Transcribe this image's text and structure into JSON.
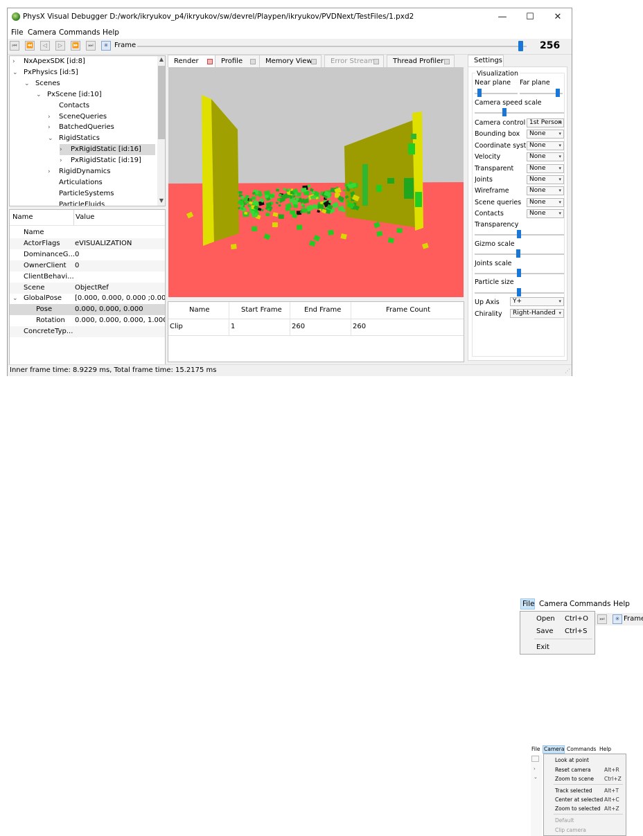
{
  "window": {
    "title": "PhysX Visual Debugger D:/work/ikryukov_p4/ikryukov/sw/devrel/Playpen/ikryukov/PVDNext/TestFiles/1.pxd2",
    "minimize": "—",
    "maximize": "☐",
    "close": "✕"
  },
  "menu": {
    "file": "File",
    "camera": "Camera",
    "commands": "Commands",
    "help": "Help"
  },
  "toolbar": {
    "frame_label": "Frame",
    "frame_value": "256",
    "frame_fraction": 0.985
  },
  "tree": [
    {
      "label": "NxApexSDK [id:8]",
      "chev": "›",
      "indent": 0
    },
    {
      "label": "PxPhysics [id:5]",
      "chev": "⌄",
      "indent": 0
    },
    {
      "label": "Scenes",
      "chev": "⌄",
      "indent": 1
    },
    {
      "label": "PxScene [id:10]",
      "chev": "⌄",
      "indent": 2
    },
    {
      "label": "Contacts",
      "chev": "",
      "indent": 3
    },
    {
      "label": "SceneQueries",
      "chev": "›",
      "indent": 3
    },
    {
      "label": "BatchedQueries",
      "chev": "›",
      "indent": 3
    },
    {
      "label": "RigidStatics",
      "chev": "⌄",
      "indent": 3
    },
    {
      "label": "PxRigidStatic [id:16]",
      "chev": "›",
      "indent": 4
    },
    {
      "label": "PxRigidStatic [id:19]",
      "chev": "›",
      "indent": 4
    },
    {
      "label": "RigidDynamics",
      "chev": "›",
      "indent": 3
    },
    {
      "label": "Articulations",
      "chev": "",
      "indent": 3
    },
    {
      "label": "ParticleSystems",
      "chev": "",
      "indent": 3
    },
    {
      "label": "ParticleFluids",
      "chev": "",
      "indent": 3
    }
  ],
  "props": {
    "header_name": "Name",
    "header_value": "Value",
    "rows": [
      {
        "name": "Name",
        "value": "",
        "indent": 1,
        "chev": ""
      },
      {
        "name": "ActorFlags",
        "value": "eVISUALIZATION",
        "indent": 1,
        "chev": ""
      },
      {
        "name": "DominanceG...",
        "value": "0",
        "indent": 1,
        "chev": ""
      },
      {
        "name": "OwnerClient",
        "value": "0",
        "indent": 1,
        "chev": ""
      },
      {
        "name": "ClientBehavi...",
        "value": "",
        "indent": 1,
        "chev": ""
      },
      {
        "name": "Scene",
        "value": "ObjectRef",
        "indent": 1,
        "chev": ""
      },
      {
        "name": "GlobalPose",
        "value": "[0.000, 0.000, 0.000 ;0.00...",
        "indent": 0,
        "chev": "⌄"
      },
      {
        "name": "Pose",
        "value": "0.000, 0.000, 0.000",
        "indent": 2,
        "chev": ""
      },
      {
        "name": "Rotation",
        "value": "0.000, 0.000, 0.000, 1.000",
        "indent": 2,
        "chev": ""
      },
      {
        "name": "ConcreteTyp...",
        "value": "",
        "indent": 1,
        "chev": ""
      }
    ]
  },
  "tabs": [
    {
      "label": "Render",
      "active": true
    },
    {
      "label": "Profile",
      "active": false
    },
    {
      "label": "Memory View",
      "active": false
    },
    {
      "label": "Error Stream",
      "active": false
    },
    {
      "label": "Thread Profiler",
      "active": false
    }
  ],
  "clips": {
    "headers": [
      "Name",
      "Start Frame",
      "End Frame",
      "Frame Count"
    ],
    "rows": [
      [
        "Clip",
        "1",
        "260",
        "260"
      ]
    ]
  },
  "settings": {
    "tab": "Settings",
    "group": "Visualization",
    "near_plane": "Near plane",
    "far_plane": "Far plane",
    "camera_speed": "Camera speed scale",
    "options": [
      {
        "label": "Camera controller",
        "value": "1st Person"
      },
      {
        "label": "Bounding box",
        "value": "None"
      },
      {
        "label": "Coordinate system",
        "value": "None"
      },
      {
        "label": "Velocity",
        "value": "None"
      },
      {
        "label": "Transparent",
        "value": "None"
      },
      {
        "label": "Joints",
        "value": "None"
      },
      {
        "label": "Wireframe",
        "value": "None"
      },
      {
        "label": "Scene queries",
        "value": "None"
      },
      {
        "label": "Contacts",
        "value": "None"
      }
    ],
    "transparency": "Transparency",
    "gizmo_scale": "Gizmo scale",
    "joints_scale": "Joints scale",
    "particle_size": "Particle size",
    "up_axis_label": "Up Axis",
    "up_axis_value": "Y+",
    "chirality_label": "Chirality",
    "chirality_value": "Right-Handed"
  },
  "status": "Inner frame time: 8.9229 ms, Total frame time: 15.2175 ms",
  "file_menu_popup": {
    "bar": [
      "File",
      "Camera",
      "Commands",
      "Help"
    ],
    "frame_label": "Frame",
    "items": [
      {
        "label": "Open",
        "shortcut": "Ctrl+O"
      },
      {
        "label": "Save",
        "shortcut": "Ctrl+S"
      },
      {
        "label": "Exit",
        "shortcut": ""
      }
    ]
  },
  "camera_menu_popup": {
    "bar": [
      "File",
      "Camera",
      "Commands",
      "Help"
    ],
    "items": [
      {
        "label": "Look at point",
        "shortcut": ""
      },
      {
        "label": "Reset camera",
        "shortcut": "Alt+R"
      },
      {
        "label": "Zoom to scene",
        "shortcut": "Ctrl+Z"
      },
      {
        "label": "Track selected",
        "shortcut": "Alt+T"
      },
      {
        "label": "Center at selected",
        "shortcut": "Alt+C"
      },
      {
        "label": "Zoom to selected",
        "shortcut": "Alt+Z"
      },
      {
        "label": "Default",
        "shortcut": ""
      },
      {
        "label": "Clip camera",
        "shortcut": ""
      }
    ]
  },
  "colors": {
    "accent": "#1a77d8",
    "floor": "#ff5a5a",
    "sky": "#c8c8c8",
    "wall": "#d9d900",
    "debris": "#22cc22"
  }
}
